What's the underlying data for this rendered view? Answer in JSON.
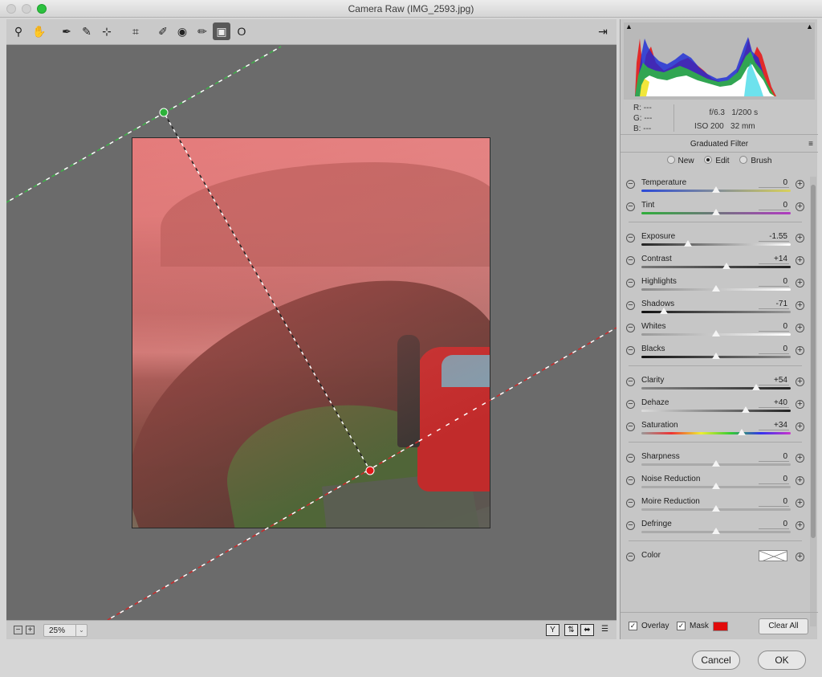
{
  "window": {
    "title": "Camera Raw (IMG_2593.jpg)"
  },
  "toolbar": {
    "tools": [
      {
        "name": "zoom-tool-icon",
        "glyph": "⚲"
      },
      {
        "name": "hand-tool-icon",
        "glyph": "✋"
      },
      {
        "name": "white-balance-tool-icon",
        "glyph": "✒"
      },
      {
        "name": "color-sampler-tool-icon",
        "glyph": "✎"
      },
      {
        "name": "targeted-adjustment-tool-icon",
        "glyph": "⊹"
      },
      {
        "name": "crop-tool-icon",
        "glyph": "⌗"
      },
      {
        "name": "spot-removal-tool-icon",
        "glyph": "✐"
      },
      {
        "name": "red-eye-tool-icon",
        "glyph": "◉"
      },
      {
        "name": "adjustment-brush-icon",
        "glyph": "✏"
      },
      {
        "name": "graduated-filter-icon",
        "glyph": "▣"
      },
      {
        "name": "radial-filter-icon",
        "glyph": "O"
      }
    ],
    "export_glyph": "⇥"
  },
  "bottombar": {
    "zoom_out": "−",
    "zoom_in": "+",
    "zoom_value": "25%",
    "zoom_dropdown": "⌄",
    "view_y": "Y",
    "view_swap": "⇅",
    "view_copy": "⬌",
    "view_prefs": "☰"
  },
  "histogram": {
    "shadow_clip_glyph": "▲",
    "highlight_clip_glyph": "▲"
  },
  "info": {
    "r_label": "R:",
    "r_value": "---",
    "g_label": "G:",
    "g_value": "---",
    "b_label": "B:",
    "b_value": "---",
    "aperture": "f/6.3",
    "shutter": "1/200 s",
    "iso": "ISO 200",
    "focal": "32 mm"
  },
  "panel": {
    "section_title": "Graduated Filter",
    "menu_glyph": "≡",
    "modes": [
      {
        "label": "New",
        "selected": false
      },
      {
        "label": "Edit",
        "selected": true
      },
      {
        "label": "Brush",
        "selected": false
      }
    ],
    "minus_glyph": "−",
    "plus_glyph": "+",
    "groups": [
      [
        {
          "label": "Temperature",
          "value": "0",
          "pos": 0.5,
          "track": "linear-gradient(90deg,#2a49d8,#d9d15a)"
        },
        {
          "label": "Tint",
          "value": "0",
          "pos": 0.5,
          "track": "linear-gradient(90deg,#2eae3a,#b13ac1)"
        }
      ],
      [
        {
          "label": "Exposure",
          "value": "-1.55",
          "pos": 0.31,
          "track": "linear-gradient(90deg,#222,#fff)"
        },
        {
          "label": "Contrast",
          "value": "+14",
          "pos": 0.57,
          "track": "linear-gradient(90deg,#777,#222)"
        },
        {
          "label": "Highlights",
          "value": "0",
          "pos": 0.5,
          "track": "linear-gradient(90deg,#8a8a8a,#fff)"
        },
        {
          "label": "Shadows",
          "value": "-71",
          "pos": 0.15,
          "track": "linear-gradient(90deg,#111,#999)"
        },
        {
          "label": "Whites",
          "value": "0",
          "pos": 0.5,
          "track": "linear-gradient(90deg,#999,#fff)"
        },
        {
          "label": "Blacks",
          "value": "0",
          "pos": 0.5,
          "track": "linear-gradient(90deg,#111,#888)"
        }
      ],
      [
        {
          "label": "Clarity",
          "value": "+54",
          "pos": 0.77,
          "track": "linear-gradient(90deg,#888,#222)"
        },
        {
          "label": "Dehaze",
          "value": "+40",
          "pos": 0.7,
          "track": "linear-gradient(90deg,#ddd,#222)"
        },
        {
          "label": "Saturation",
          "value": "+34",
          "pos": 0.67,
          "track": "linear-gradient(90deg,#999,#e33,#ee3,#3c3,#33e,#c3c)"
        }
      ],
      [
        {
          "label": "Sharpness",
          "value": "0",
          "pos": 0.5,
          "track": "linear-gradient(90deg,#aaa,#aaa)"
        },
        {
          "label": "Noise Reduction",
          "value": "0",
          "pos": 0.5,
          "track": "linear-gradient(90deg,#aaa,#aaa)"
        },
        {
          "label": "Moire Reduction",
          "value": "0",
          "pos": 0.5,
          "track": "linear-gradient(90deg,#aaa,#aaa)"
        },
        {
          "label": "Defringe",
          "value": "0",
          "pos": 0.5,
          "track": "linear-gradient(90deg,#aaa,#aaa)"
        }
      ]
    ],
    "color_label": "Color"
  },
  "footer": {
    "overlay_label": "Overlay",
    "overlay_checked": "✓",
    "mask_label": "Mask",
    "mask_checked": "✓",
    "mask_color": "#e10b0b",
    "clear_all": "Clear All"
  },
  "dialog": {
    "cancel": "Cancel",
    "ok": "OK"
  },
  "colors": {
    "overlay_tint": "#e25a5a",
    "gradient_start_color": "#2db23a",
    "gradient_end_color": "#e11818",
    "active_tool_bg": "#585858"
  }
}
